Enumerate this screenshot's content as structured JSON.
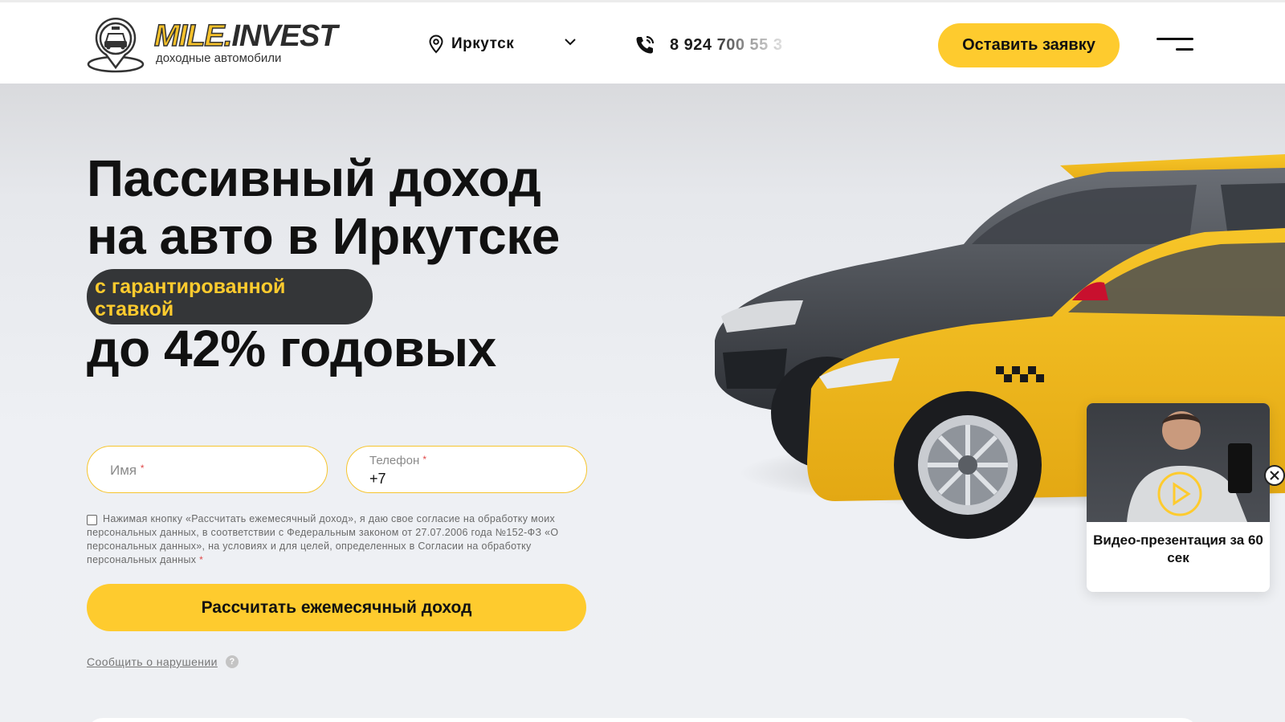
{
  "header": {
    "logo": {
      "word_yellow": "MILE.",
      "word_dark": "INVEST",
      "tagline": "доходные автомобили"
    },
    "city": "Иркутск",
    "phone": "8 924 700 55 3",
    "cta_label": "Оставить заявку"
  },
  "hero": {
    "title_line1": "Пассивный доход",
    "title_line2": "на авто в Иркутске",
    "highlight": "с гарантированной ставкой",
    "title_line3": "до 42% годовых"
  },
  "form": {
    "name_placeholder": "Имя",
    "phone_label": "Телефон",
    "phone_value": "+7",
    "required_mark": "*",
    "consent_text": "Нажимая кнопку «Рассчитать ежемесячный доход», я даю свое согласие на обработку моих персональных данных, в соответствии с Федеральным законом от 27.07.2006 года №152-ФЗ «О персональных данных», на условиях и для целей, определенных в Согласии на обработку персональных данных",
    "submit_label": "Рассчитать ежемесячный доход",
    "report_link": "Сообщить о нарушении",
    "help_symbol": "?"
  },
  "video": {
    "caption": "Видео-презентация за 60 сек"
  },
  "colors": {
    "accent": "#fecb2e",
    "pill_bg": "#343638",
    "text": "#111111",
    "required": "#e04848"
  },
  "icons": [
    "taxi-logo-icon",
    "location-pin-icon",
    "chevron-down-icon",
    "phone-icon",
    "burger-menu-icon",
    "help-icon",
    "play-icon",
    "close-icon"
  ]
}
